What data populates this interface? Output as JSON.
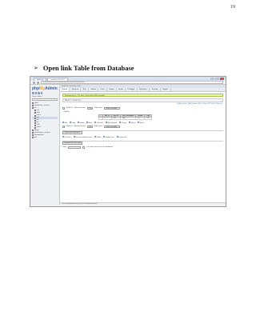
{
  "page_number": "19",
  "heading": {
    "bullet": "➢",
    "text": "Open link Table from Database"
  },
  "screenshot": {
    "tabs": [
      "local / Inv",
      "localhost / 127.0.0.1"
    ],
    "url": "localhost/phpmyadmin/sql.php?db=inventory&table=link&token",
    "sidebar": {
      "logo": "phpMyAdmin",
      "recent_label": "Recent tables",
      "items": [
        {
          "label": "cdcol",
          "sub": false
        },
        {
          "label": "information_schema",
          "sub": false
        },
        {
          "label": "inv",
          "sub": false
        },
        {
          "label": "cat",
          "sub": true
        },
        {
          "label": "dept",
          "sub": true
        },
        {
          "label": "items",
          "sub": true
        },
        {
          "label": "link",
          "sub": true
        },
        {
          "label": "pur",
          "sub": true
        },
        {
          "label": "rec",
          "sub": true
        },
        {
          "label": "sale",
          "sub": true
        },
        {
          "label": "vend",
          "sub": true
        },
        {
          "label": "mysql",
          "sub": false
        },
        {
          "label": "performance_schema",
          "sub": false
        },
        {
          "label": "phpmyadmin",
          "sub": false
        },
        {
          "label": "test",
          "sub": false
        }
      ]
    },
    "breadcrumb": "localhost » inventory » link",
    "nav": [
      "Browse",
      "Structure",
      "SQL",
      "Search",
      "Insert",
      "Export",
      "Import",
      "Privileges",
      "Operations",
      "Tracking",
      "Triggers"
    ],
    "success": "Showing rows 0 - 0 (1 total, Query took 0.0002 seconds)",
    "sql": "SELECT * FROM `link`",
    "profiling": "Profiling [ Inline ] [ Edit ] [ Explain SQL ] [ Create PHP Code ] [ Refresh ]",
    "controls": {
      "show_label": "Show all",
      "rows_label": "Number of rows:",
      "rows_value": "25",
      "filter_label": "Filter rows:",
      "filter_placeholder": "Search this table"
    },
    "options": "+ Options",
    "columns": [
      "",
      "link_id",
      "item_id",
      "item_description",
      "vendor",
      "cost"
    ],
    "row": [
      "",
      "1",
      "101",
      "Item",
      "V1",
      "120"
    ],
    "actions_top": [
      "Edit",
      "Copy",
      "Delete",
      "Show",
      "Check all",
      "With selected:",
      "Change",
      "Delete",
      "Export"
    ],
    "query_ops_label": "Query results operations",
    "query_ops": [
      "Print view",
      "Print view (with full texts)",
      "Export",
      "Display chart",
      "Create view"
    ],
    "bookmark_label": "Bookmark this SQL query",
    "bookmark_field": "Label:",
    "bookmark_check": "Let every user access this bookmark",
    "status": "localhost/phpmyadmin/sql.php?db=inventory&table=link"
  }
}
